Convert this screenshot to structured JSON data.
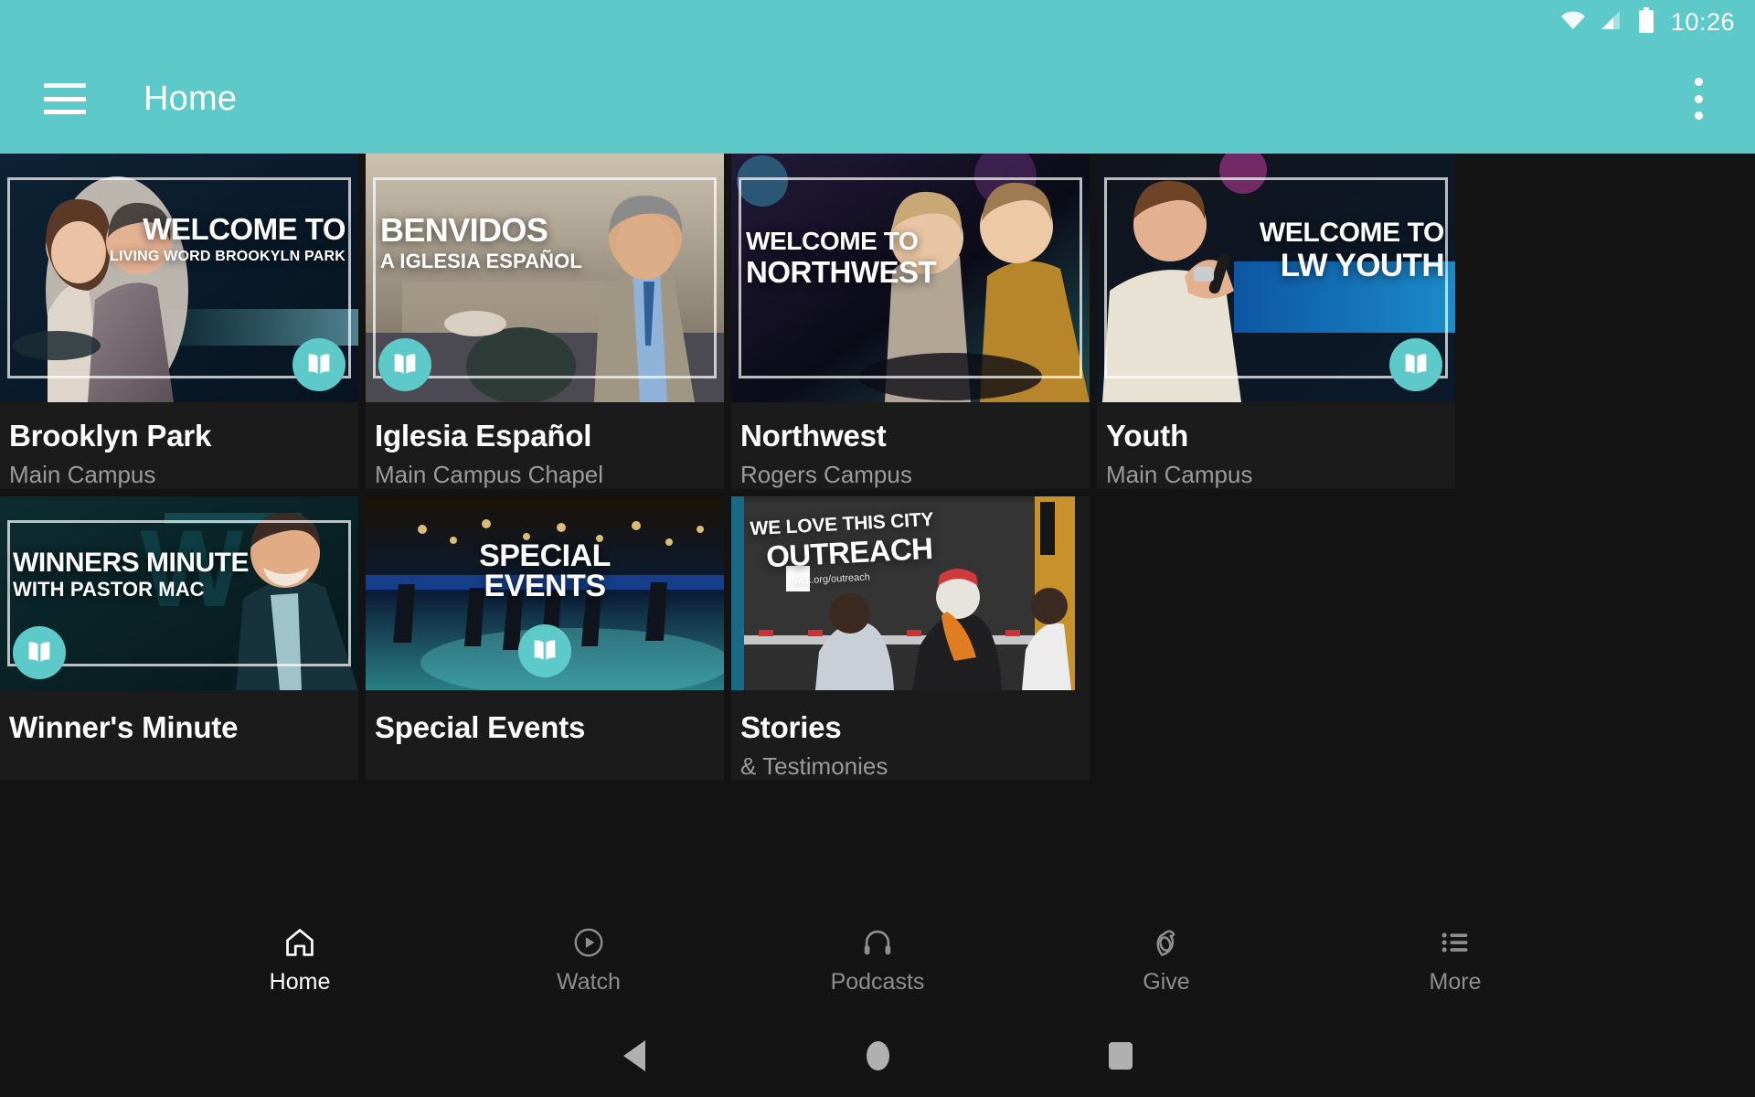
{
  "status_bar": {
    "time": "10:26",
    "icons": [
      "wifi-icon",
      "cellular-signal-icon",
      "battery-icon"
    ]
  },
  "app_bar": {
    "title": "Home",
    "menu_icon": "hamburger-menu-icon",
    "overflow_icon": "overflow-menu-icon",
    "accent_color": "#5EC9C9"
  },
  "theme": {
    "accent": "#5EC9C9",
    "background": "#131313",
    "card_background": "#1b1b1b",
    "title_color": "#ffffff",
    "subtitle_color": "#9b9b9b"
  },
  "cards": [
    {
      "title": "Brooklyn Park",
      "subtitle": "Main Campus",
      "overlay_line1": "WELCOME TO",
      "overlay_line2": "LIVING WORD BROOKYLN PARK",
      "badge": "book-icon",
      "badge_position": "bottom-right"
    },
    {
      "title": "Iglesia Español",
      "subtitle": "Main Campus Chapel",
      "overlay_line1": "BENVIDOS",
      "overlay_line2": "A IGLESIA ESPAÑOL",
      "badge": "book-icon",
      "badge_position": "bottom-left"
    },
    {
      "title": "Northwest",
      "subtitle": "Rogers Campus",
      "overlay_line1": "WELCOME TO",
      "overlay_line2": "NORTHWEST",
      "badge": "",
      "badge_position": "none"
    },
    {
      "title": "Youth",
      "subtitle": "Main Campus",
      "overlay_line1": "WELCOME TO",
      "overlay_line2": "LW YOUTH",
      "badge": "book-icon",
      "badge_position": "bottom-right"
    },
    {
      "title": "Winner's Minute",
      "subtitle": "",
      "overlay_line1": "WINNERS MINUTE",
      "overlay_line2": "WITH PASTOR MAC",
      "badge": "book-icon",
      "badge_position": "bottom-left"
    },
    {
      "title": "Special Events",
      "subtitle": "",
      "overlay_line1": "SPECIAL",
      "overlay_line2": "EVENTS",
      "badge": "book-icon",
      "badge_position": "center-bottom"
    },
    {
      "title": "Stories",
      "subtitle": "& Testimonies",
      "overlay_line1": "WE LOVE THIS CITY",
      "overlay_line2": "OUTREACH",
      "overlay_line3": "lwcc.org/outreach",
      "badge": "",
      "badge_position": "none"
    }
  ],
  "bottom_nav": {
    "items": [
      {
        "label": "Home",
        "icon": "home-icon",
        "active": true
      },
      {
        "label": "Watch",
        "icon": "play-circle-icon",
        "active": false
      },
      {
        "label": "Podcasts",
        "icon": "headphones-icon",
        "active": false
      },
      {
        "label": "Give",
        "icon": "giving-hand-icon",
        "active": false
      },
      {
        "label": "More",
        "icon": "list-icon",
        "active": false
      }
    ]
  },
  "system_nav": {
    "back": "back-triangle-icon",
    "home": "home-circle-icon",
    "recents": "recents-square-icon"
  }
}
